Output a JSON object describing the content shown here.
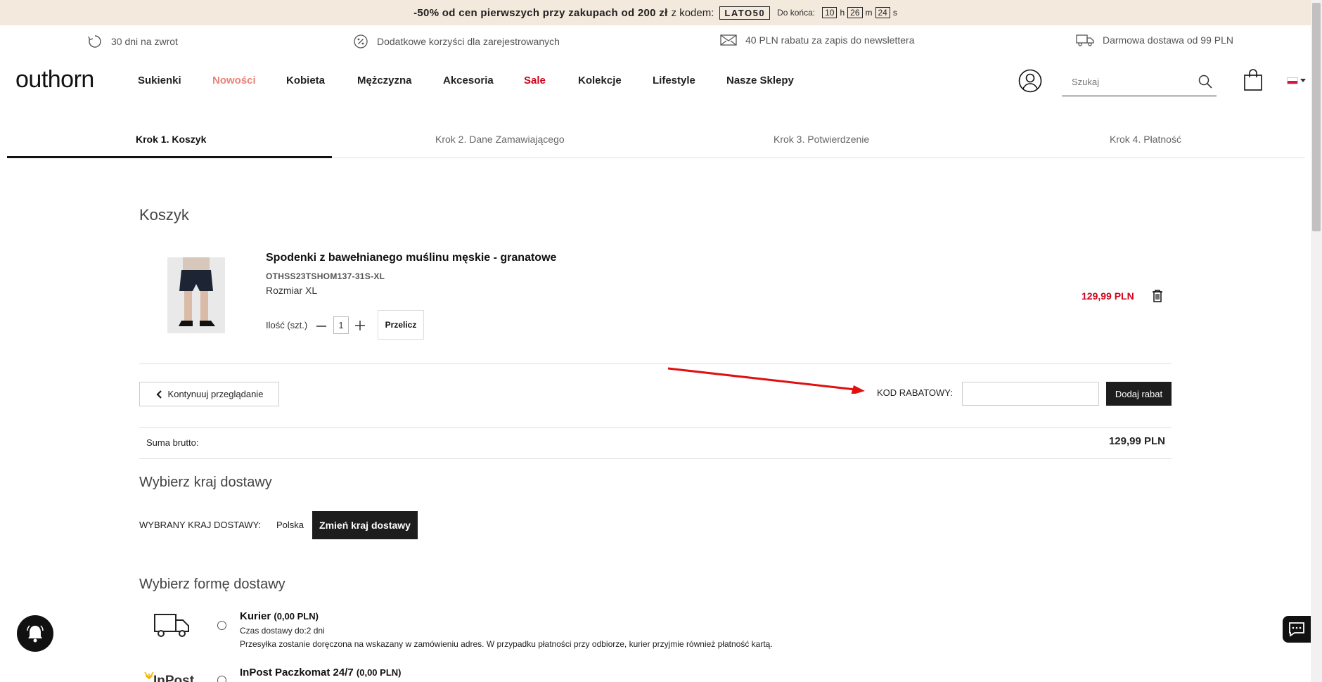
{
  "promo": {
    "text_bold": "-50% od cen pierwszych przy zakupach od 200 zł",
    "text_rest": "z kodem:",
    "code": "LATO50",
    "countdown_label": "Do końca:",
    "hours": "10",
    "h": "h",
    "minutes": "26",
    "m": "m",
    "seconds": "24",
    "s": "s"
  },
  "benefits": [
    {
      "icon": "return-icon",
      "label": "30 dni na zwrot"
    },
    {
      "icon": "percent-icon",
      "label": "Dodatkowe korzyści dla zarejestrowanych"
    },
    {
      "icon": "envelope-icon",
      "label": "40 PLN rabatu za zapis do newslettera"
    },
    {
      "icon": "truck-icon",
      "label": "Darmowa dostawa od 99 PLN"
    }
  ],
  "header": {
    "logo": "outhorn",
    "nav": [
      "Sukienki",
      "Nowości",
      "Kobieta",
      "Mężczyzna",
      "Akcesoria",
      "Sale",
      "Kolekcje",
      "Lifestyle",
      "Nasze Sklepy"
    ],
    "search_placeholder": "Szukaj"
  },
  "colors": {
    "accent_sale": "#d0021b",
    "accent_new": "#e8837a",
    "dark": "#1d1d1d",
    "promo_bg": "#f3e9dc"
  },
  "steps": [
    "Krok 1. Koszyk",
    "Krok 2. Dane Zamawiającego",
    "Krok 3. Potwierdzenie",
    "Krok 4. Płatność"
  ],
  "cart": {
    "title": "Koszyk",
    "item": {
      "name": "Spodenki z bawełnianego muślinu męskie - granatowe",
      "sku": "OTHSS23TSHOM137-31S-XL",
      "size": "Rozmiar XL",
      "qty_label": "Ilość (szt.)",
      "qty": "1",
      "recalc": "Przelicz",
      "price": "129,99 PLN"
    },
    "continue": "Kontynuuj przeglądanie",
    "discount_label": "KOD RABATOWY:",
    "discount_button": "Dodaj rabat",
    "sum_label": "Suma brutto:",
    "sum_value": "129,99 PLN"
  },
  "country": {
    "title": "Wybierz kraj dostawy",
    "label": "WYBRANY KRAJ DOSTAWY:",
    "value": "Polska",
    "button": "Zmień kraj dostawy"
  },
  "delivery": {
    "title": "Wybierz formę dostawy",
    "options": [
      {
        "name": "Kurier",
        "price": "(0,00 PLN)",
        "time": "Czas dostawy do:2 dni",
        "desc": "Przesyłka zostanie doręczona na wskazany w zamówieniu adres. W przypadku płatności przy odbiorze, kurier przyjmie również płatność kartą."
      },
      {
        "name": "InPost Paczkomat 24/7",
        "price": "(0,00 PLN)",
        "logo_text": "InPost"
      }
    ]
  }
}
